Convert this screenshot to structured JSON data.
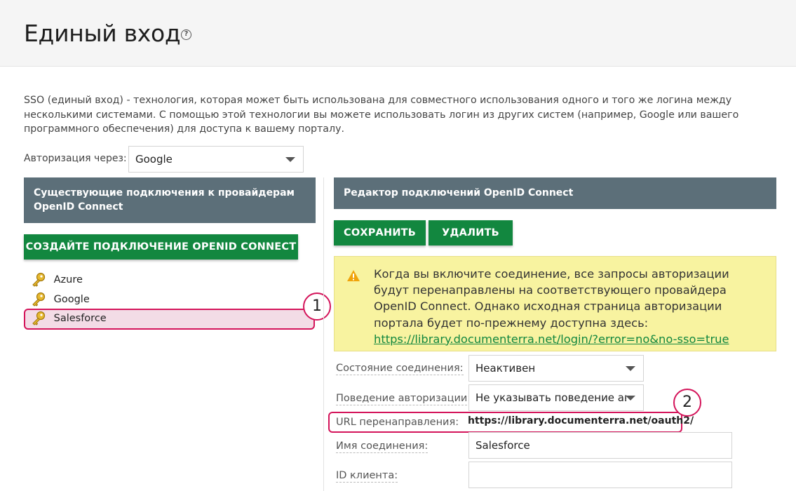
{
  "header": {
    "title": "Единый вход",
    "help_icon": "?"
  },
  "description": "SSO (единый вход) - технология, которая может быть использована для совместного использования одного и того же логина между несколькими системами. С помощью этой технологии вы можете использовать логин из других систем (например, Google или вашего программного обеспечения) для доступа к вашему порталу.",
  "auth": {
    "label": "Авторизация через:",
    "selected": "Google"
  },
  "left_panel": {
    "header": "Существующие подключения к провайдерам OpenID Connect",
    "create_button": "СОЗДАЙТЕ ПОДКЛЮЧЕНИЕ OPENID CONNECT",
    "connections": [
      {
        "name": "Azure",
        "icon": "key-icon"
      },
      {
        "name": "Google",
        "icon": "key-icon"
      },
      {
        "name": "Salesforce",
        "icon": "key-icon"
      }
    ]
  },
  "right_panel": {
    "header": "Редактор подключений OpenID Connect",
    "save_button": "СОХРАНИТЬ",
    "delete_button": "УДАЛИТЬ",
    "warning_text": "Когда вы включите соединение, все запросы авторизации будут перенаправлены на соответствующего провайдера OpenID Connect. Однако исходная страница авторизации портала будет по-прежнему доступна здесь:",
    "warning_link": "https://library.documenterra.net/login/?error=no&no-sso=true",
    "fields": {
      "state_label": "Состояние соединения:",
      "state_value": "Неактивен",
      "behavior_label": "Поведение авторизации:",
      "behavior_value": "Не указывать поведение ав",
      "redirect_label": "URL перенаправления:",
      "redirect_value": "https://library.documenterra.net/oauth2/",
      "name_label": "Имя соединения:",
      "name_value": "Salesforce",
      "client_id_label": "ID клиента:",
      "client_id_value": ""
    }
  },
  "callouts": {
    "one": "1",
    "two": "2"
  },
  "colors": {
    "accent_green": "#12873f",
    "panel_header": "#5c6f79",
    "highlight": "#d4145a",
    "warning_bg": "#f8f3a0"
  }
}
